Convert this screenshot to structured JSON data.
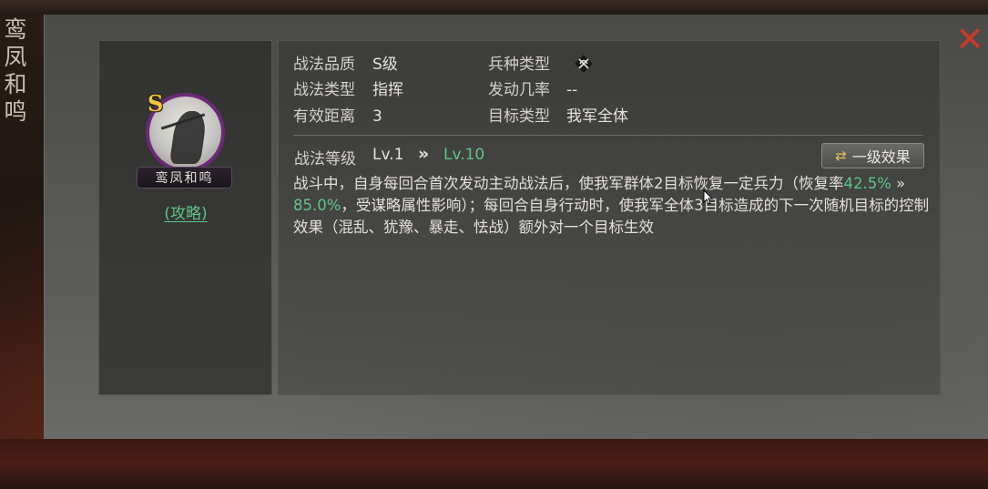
{
  "side_title": [
    "鸾",
    "凤",
    "和",
    "鸣"
  ],
  "close_label": "✕",
  "skill": {
    "grade": "S",
    "name": "鸾凤和鸣",
    "strategy_link": "(攻略)"
  },
  "attributes": {
    "quality_label": "战法品质",
    "quality_value": "S级",
    "troop_label": "兵种类型",
    "type_label": "战法类型",
    "type_value": "指挥",
    "chance_label": "发动几率",
    "chance_value": "--",
    "range_label": "有效距离",
    "range_value": "3",
    "target_label": "目标类型",
    "target_value": "我军全体"
  },
  "level": {
    "label": "战法等级",
    "current": "Lv.1",
    "arrow": "»",
    "max": "Lv.10",
    "button_label": "一级效果"
  },
  "description": {
    "part1": "战斗中，自身每回合首次发动主动战法后，使我军群体2目标恢复一定兵力（恢复率",
    "value_from": "42.5%",
    "arrow": "»",
    "value_to": "85.0%",
    "part2": "，受谋略属性影响）；每回合自身行动时，使我军全体3目标造成的下一次随机目标的控制效果（混乱、犹豫、暴走、怯战）额外对一个目标生效"
  },
  "colors": {
    "accent_green": "#5ec48a",
    "close_red": "#c83a2a",
    "grade_gold": "#f2c63a",
    "avatar_ring": "#6b2a78"
  },
  "icons": {
    "troop": "troop-type-icon",
    "swap": "swap-icon",
    "close": "close-icon"
  }
}
